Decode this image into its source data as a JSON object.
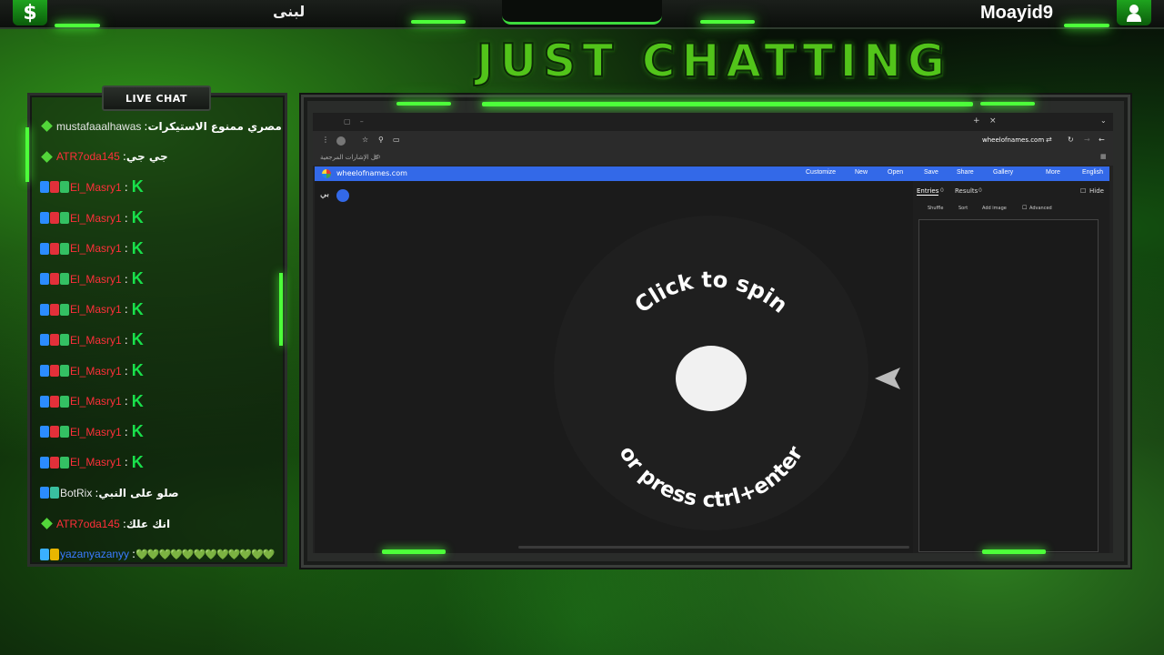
{
  "topbar": {
    "left_icon": "dollar-icon",
    "left_symbol": "$",
    "left_name": "لبنى",
    "right_name": "Moayid9",
    "right_icon": "user-icon"
  },
  "title": "JUST CHATTING",
  "chat": {
    "header": "LIVE CHAT",
    "messages": [
      {
        "user": "mustafaaalhawas",
        "sep": " : ",
        "text": "مصري ممنوع الاستيكرات",
        "user_color": "#e6e6e6"
      },
      {
        "user": "ATR7oda145",
        "sep": " : ",
        "text": "جي جي",
        "user_color": "#ff2f3a"
      },
      {
        "user": "El_Masry1",
        "sep": " : ",
        "text": "K",
        "user_color": "#ff2f3a",
        "badges": true
      },
      {
        "user": "El_Masry1",
        "sep": " : ",
        "text": "K",
        "user_color": "#ff2f3a",
        "badges": true
      },
      {
        "user": "El_Masry1",
        "sep": " : ",
        "text": "K",
        "user_color": "#ff2f3a",
        "badges": true
      },
      {
        "user": "El_Masry1",
        "sep": " : ",
        "text": "K",
        "user_color": "#ff2f3a",
        "badges": true
      },
      {
        "user": "El_Masry1",
        "sep": " : ",
        "text": "K",
        "user_color": "#ff2f3a",
        "badges": true
      },
      {
        "user": "El_Masry1",
        "sep": " : ",
        "text": "K",
        "user_color": "#ff2f3a",
        "badges": true
      },
      {
        "user": "El_Masry1",
        "sep": " : ",
        "text": "K",
        "user_color": "#ff2f3a",
        "badges": true
      },
      {
        "user": "El_Masry1",
        "sep": " : ",
        "text": "K",
        "user_color": "#ff2f3a",
        "badges": true
      },
      {
        "user": "El_Masry1",
        "sep": " : ",
        "text": "K",
        "user_color": "#ff2f3a",
        "badges": true
      },
      {
        "user": "El_Masry1",
        "sep": " : ",
        "text": "K",
        "user_color": "#ff2f3a",
        "badges": true
      },
      {
        "user": "BotRix",
        "sep": " : ",
        "text": "صلو على النبي",
        "user_color": "#e6e6e6",
        "bot": true
      },
      {
        "user": "ATR7oda145",
        "sep": " : ",
        "text": "انك علك",
        "user_color": "#ff2f3a"
      },
      {
        "user": "yazanyazanyy",
        "sep": " : ",
        "text": "💚💚💚💚💚💚💚💚💚💚💚💚",
        "user_color": "#3a7bff",
        "emotes": true
      }
    ]
  },
  "browser": {
    "url": "wheelofnames.com",
    "bookmarks_label": "كل الإشارات المرجعية",
    "site_name": "wheelofnames.com",
    "menu": [
      "Customize",
      "New",
      "Open",
      "Save",
      "Share",
      "Gallery",
      "More",
      "English"
    ],
    "wheel_title": "بي",
    "spin_text_top": "Click to spin",
    "spin_text_bottom": "or press ctrl+enter",
    "tabs": {
      "entries": "Entries",
      "entries_count": "0",
      "results": "Results",
      "results_count": "0"
    },
    "hide_label": "Hide",
    "tools": {
      "shuffle": "Shuffle",
      "sort": "Sort",
      "add_image": "Add image",
      "advanced": "Advanced"
    }
  }
}
